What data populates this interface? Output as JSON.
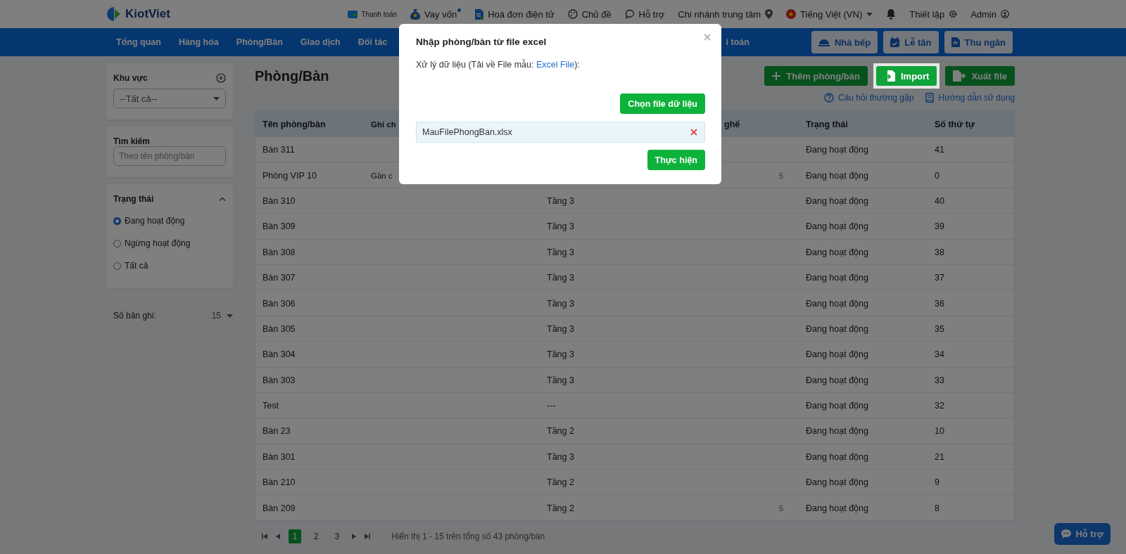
{
  "top_bar": {
    "logo": "KiotViet",
    "items": [
      {
        "kind": "payment",
        "label": "Thanh toán",
        "small": true
      },
      {
        "kind": "loan",
        "label": "Vay vốn",
        "dot": true
      },
      {
        "kind": "invoice",
        "label": "Hoá đơn điện tử"
      },
      {
        "kind": "theme",
        "label": "Chủ đề"
      },
      {
        "kind": "support",
        "label": "Hỗ trợ"
      },
      {
        "kind": "branch",
        "label": "Chi nhánh trung tâm"
      },
      {
        "kind": "language",
        "label": "Tiếng Việt (VN)"
      },
      {
        "kind": "bell"
      },
      {
        "kind": "settings",
        "label": "Thiết lập"
      },
      {
        "kind": "account",
        "label": "Admin"
      }
    ]
  },
  "nav": {
    "items": [
      {
        "label": "Tổng quan"
      },
      {
        "label": "Hàng hóa"
      },
      {
        "label": "Phòng/Bàn"
      },
      {
        "label": "Giao dịch"
      },
      {
        "label": "Đối tác"
      }
    ],
    "partial_item": "i toán",
    "buttons": [
      {
        "kind": "kitchen",
        "label": "Nhà bếp"
      },
      {
        "kind": "reception",
        "label": "Lễ tân"
      },
      {
        "kind": "cashier",
        "label": "Thu ngân"
      }
    ]
  },
  "sidebar": {
    "area_filter": {
      "title": "Khu vực",
      "value": "--Tất cả--"
    },
    "search": {
      "title": "Tìm kiếm",
      "placeholder": "Theo tên phòng/bàn"
    },
    "status_filter": {
      "title": "Trạng thái",
      "expanded": true,
      "options": [
        {
          "label": "Đang hoạt động",
          "selected": true
        },
        {
          "label": "Ngừng hoạt động",
          "selected": false
        },
        {
          "label": "Tất cả",
          "selected": false
        }
      ]
    },
    "records": {
      "label": "Số bản ghi:",
      "value": "15"
    }
  },
  "main": {
    "title": "Phòng/Bàn",
    "actions": [
      {
        "kind": "add",
        "label": "Thêm phòng/bàn",
        "highlighted": false
      },
      {
        "kind": "import",
        "label": "Import",
        "highlighted": true
      },
      {
        "kind": "export",
        "label": "Xuất file",
        "highlighted": false
      }
    ],
    "help_links": [
      {
        "kind": "faq",
        "label": "Câu hỏi thường gặp"
      },
      {
        "kind": "guide",
        "label": "Hướng dẫn sử dụng"
      }
    ]
  },
  "table": {
    "columns": [
      "Tên phòng/bàn",
      "Ghi ch",
      null,
      "ghế",
      "Trạng thái",
      "Số thứ tự"
    ],
    "rows": [
      [
        "Bàn 311",
        null,
        null,
        null,
        "Đang hoạt động",
        "41"
      ],
      [
        "Phòng VIP 10",
        "Gần c",
        null,
        "5",
        "Đang hoạt động",
        "0"
      ],
      [
        "Bàn 310",
        null,
        "Tầng 3",
        null,
        "Đang hoạt động",
        "40"
      ],
      [
        "Bàn 309",
        null,
        "Tầng 3",
        null,
        "Đang hoạt động",
        "39"
      ],
      [
        "Bàn 308",
        null,
        "Tầng 3",
        null,
        "Đang hoạt động",
        "38"
      ],
      [
        "Bàn 307",
        null,
        "Tầng 3",
        null,
        "Đang hoạt động",
        "37"
      ],
      [
        "Bàn 306",
        null,
        "Tầng 3",
        null,
        "Đang hoạt động",
        "36"
      ],
      [
        "Bàn 305",
        null,
        "Tầng 3",
        null,
        "Đang hoạt động",
        "35"
      ],
      [
        "Bàn 304",
        null,
        "Tầng 3",
        null,
        "Đang hoạt động",
        "34"
      ],
      [
        "Bàn 303",
        null,
        "Tầng 3",
        null,
        "Đang hoạt động",
        "33"
      ],
      [
        "Test",
        null,
        "---",
        null,
        "Đang hoạt động",
        "32"
      ],
      [
        "Bàn 23",
        null,
        "Tầng 2",
        null,
        "Đang hoạt động",
        "10"
      ],
      [
        "Bàn 301",
        null,
        "Tầng 3",
        null,
        "Đang hoạt động",
        "21"
      ],
      [
        "Bàn 210",
        null,
        "Tầng 2",
        null,
        "Đang hoạt động",
        "9"
      ],
      [
        "Bàn 209",
        null,
        "Tầng 2",
        "5",
        "Đang hoạt động",
        "8"
      ]
    ]
  },
  "pagination": {
    "pages": [
      {
        "label": "1",
        "selected": true
      },
      {
        "label": "2",
        "selected": false
      },
      {
        "label": "3",
        "selected": false
      }
    ],
    "summary": "Hiển thị 1 - 15 trên tổng số 43 phòng/bàn"
  },
  "support_button": {
    "label": "Hỗ trợ"
  },
  "modal": {
    "title": "Nhập phòng/bàn từ file excel",
    "text_before": "Xử lý dữ liệu (Tải về File mẫu: ",
    "link": "Excel File",
    "text_after": "):",
    "choose_button": "Chọn file dữ liệu",
    "file": {
      "name": "MauFilePhongBan.xlsx"
    },
    "submit_button": "Thực hiện"
  }
}
